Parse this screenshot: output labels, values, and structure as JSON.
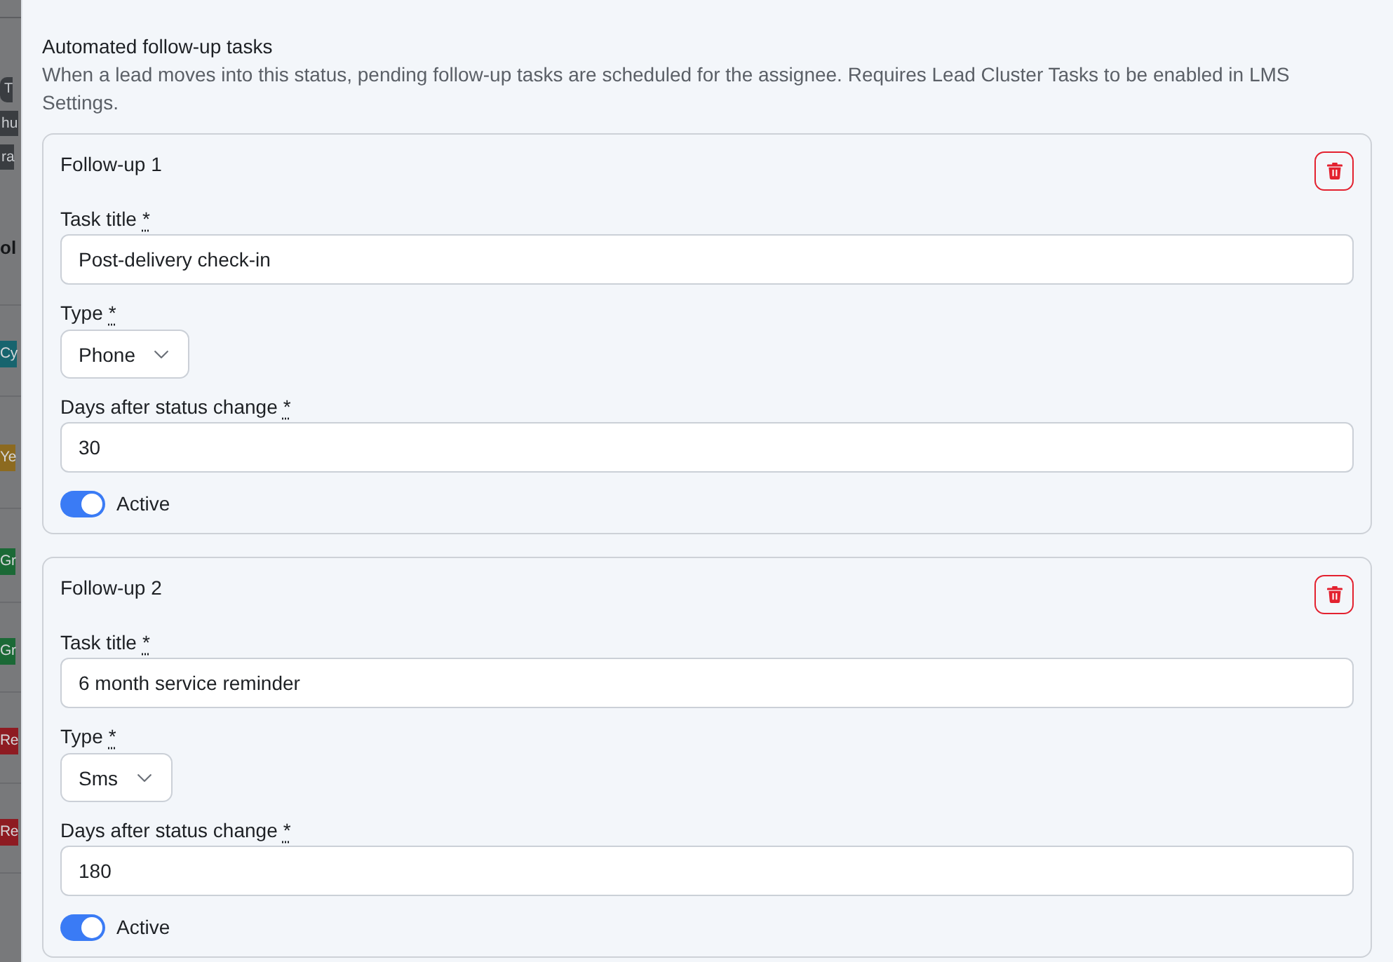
{
  "background_page": {
    "tags": [
      {
        "text": "T"
      },
      {
        "text": "hu"
      },
      {
        "text": "ra"
      }
    ],
    "heading": "ol",
    "rows": [
      {
        "status": "Cy",
        "color": "#17646e"
      },
      {
        "status": "Ye",
        "color": "#8c6a20"
      },
      {
        "status": "Gr",
        "color": "#1b6936"
      },
      {
        "status": "Gr",
        "color": "#1b6936"
      },
      {
        "status": "Re",
        "color": "#8e1b22"
      },
      {
        "status": "Re",
        "color": "#8e1b22"
      }
    ]
  },
  "section": {
    "title": "Automated follow-up tasks",
    "description": "When a lead moves into this status, pending follow-up tasks are scheduled for the assignee. Requires Lead Cluster Tasks to be enabled in LMS Settings."
  },
  "follow_ups": [
    {
      "title": "Follow-up 1",
      "fields": [
        {
          "kind": "text",
          "label": "Task title",
          "required_mark": "*",
          "value": "Post-delivery check-in"
        },
        {
          "kind": "select",
          "label": "Type",
          "required_mark": "*",
          "value": "Phone"
        },
        {
          "kind": "text",
          "label": "Days after status change",
          "required_mark": "*",
          "value": "30"
        }
      ],
      "active": true,
      "active_label": "Active"
    },
    {
      "title": "Follow-up 2",
      "fields": [
        {
          "kind": "text",
          "label": "Task title",
          "required_mark": "*",
          "value": "6 month service reminder"
        },
        {
          "kind": "select",
          "label": "Type",
          "required_mark": "*",
          "value": "Sms"
        },
        {
          "kind": "text",
          "label": "Days after status change",
          "required_mark": "*",
          "value": "180"
        }
      ],
      "active": true,
      "active_label": "Active"
    }
  ]
}
